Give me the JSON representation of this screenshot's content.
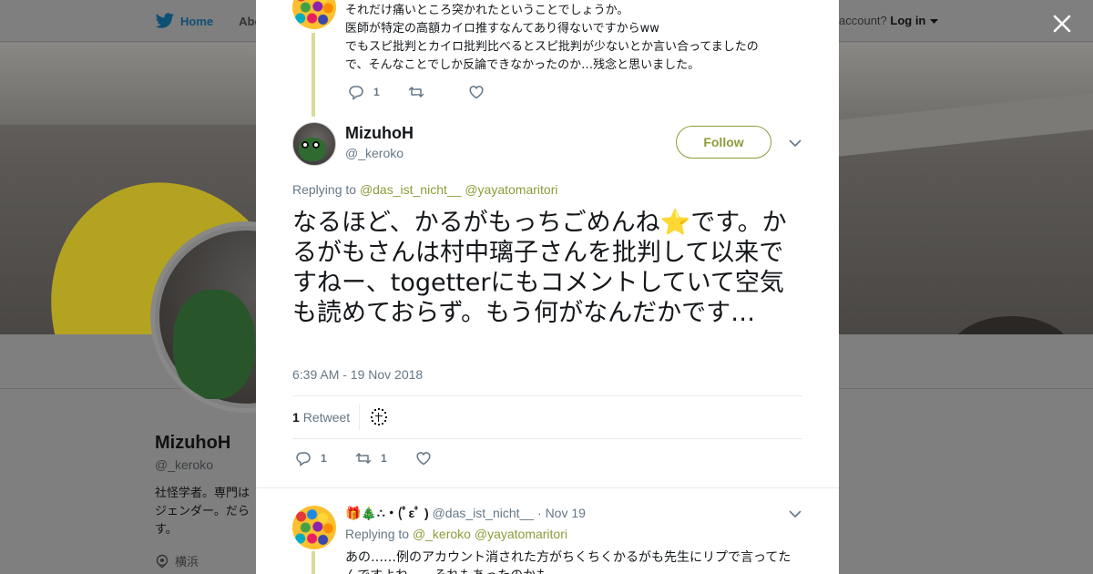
{
  "background": {
    "nav": {
      "home_label": "Home",
      "about_label": "Abo",
      "account_prompt": "account?",
      "login_label": "Log in"
    },
    "profile": {
      "name": "MizuhoH",
      "handle": "@_keroko",
      "bio_lines": [
        "社怪学者。専門は",
        "ジェンダー。だら",
        "す。"
      ],
      "location": "横浜"
    }
  },
  "modal": {
    "previous_tweet": {
      "text_lines": [
        "それだけ痛いところ突かれたということでしょうか。",
        "医師が特定の高額カイロ推すなんてあり得ないですからww",
        "でもスピ批判とカイロ批判比べるとスピ批判が少ないとか言い合ってましたの",
        "で、そんなことでしか反論できなかったのか…残念と思いました。"
      ],
      "reply_count": "1",
      "retweet_count": "",
      "like_count": ""
    },
    "main_tweet": {
      "name": "MizuhoH",
      "handle": "@_keroko",
      "follow_label": "Follow",
      "replying_prefix": "Replying to",
      "mentions": [
        "@das_ist_nicht__",
        "@yayatomaritori"
      ],
      "text": "なるほど、かるがもっちごめんね⭐です。かるがもさんは村中璃子さんを批判して以来ですねー、togetterにもコメントしていて空気も読めておらず。もう何がなんだかです…",
      "timestamp": "6:39 AM - 19 Nov 2018",
      "retweets_num": "1",
      "retweets_label": "Retweet",
      "reply_count": "1",
      "retweet_count": "1",
      "like_count": ""
    },
    "reply_tweet": {
      "name": "🎁🎄∴・(ﾟεﾟ )",
      "handle": "@das_ist_nicht__",
      "separator": "·",
      "time": "Nov 19",
      "replying_prefix": "Replying to",
      "mentions": [
        "@_keroko",
        "@yayatomaritori"
      ],
      "text": "あの……例のアカウント消された方がちくちくかるがも先生にリプで言ってたんですよね……それもあったのかも"
    }
  },
  "colors": {
    "accent": "#8f9b3a",
    "thread_line": "#d9db9e",
    "secondary_text": "#657786",
    "overlay_bg": "#7f7f7f"
  },
  "icons": {
    "nav_logo": "bird-icon",
    "close": "close-icon",
    "reply": "reply-icon",
    "retweet": "retweet-icon",
    "like": "heart-icon",
    "caret": "chevron-down-icon",
    "location": "location-pin-icon"
  }
}
